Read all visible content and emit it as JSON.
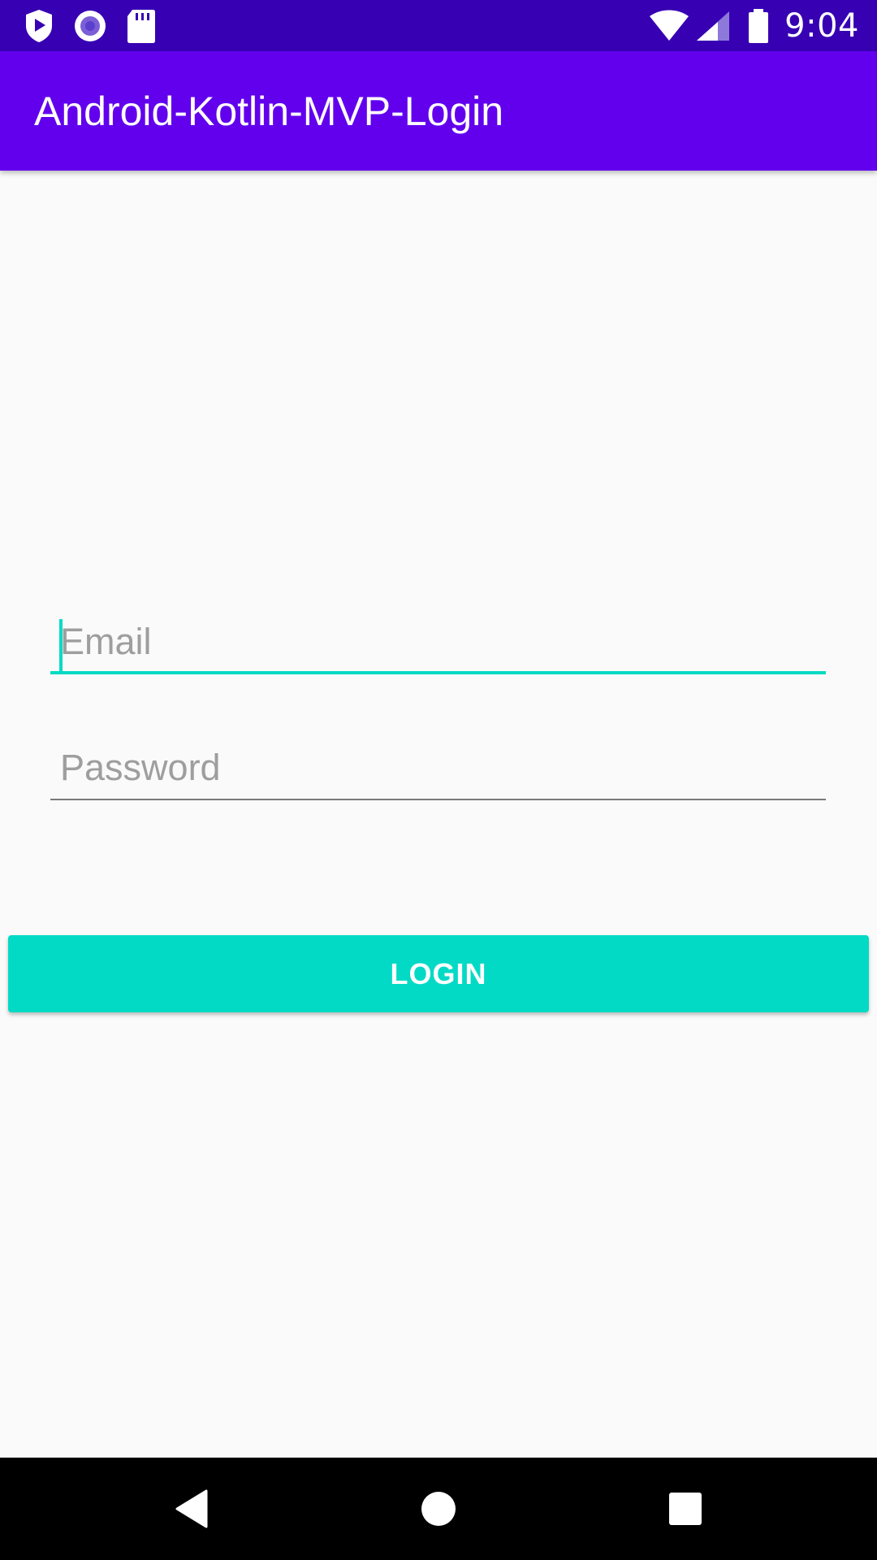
{
  "status_bar": {
    "time": "9:04",
    "left_icons": [
      "play-protect-icon",
      "record-icon",
      "sd-card-icon"
    ],
    "right_icons": [
      "wifi-icon",
      "cell-signal-icon",
      "battery-icon"
    ]
  },
  "app_bar": {
    "title": "Android-Kotlin-MVP-Login"
  },
  "form": {
    "email": {
      "placeholder": "Email",
      "value": ""
    },
    "password": {
      "placeholder": "Password",
      "value": ""
    },
    "login_label": "LOGIN"
  },
  "nav_bar": {
    "buttons": [
      "back-icon",
      "home-icon",
      "recents-icon"
    ]
  },
  "colors": {
    "status_bar": "#3700b3",
    "primary": "#6200ee",
    "accent": "#03dac5",
    "background": "#fafafa"
  }
}
